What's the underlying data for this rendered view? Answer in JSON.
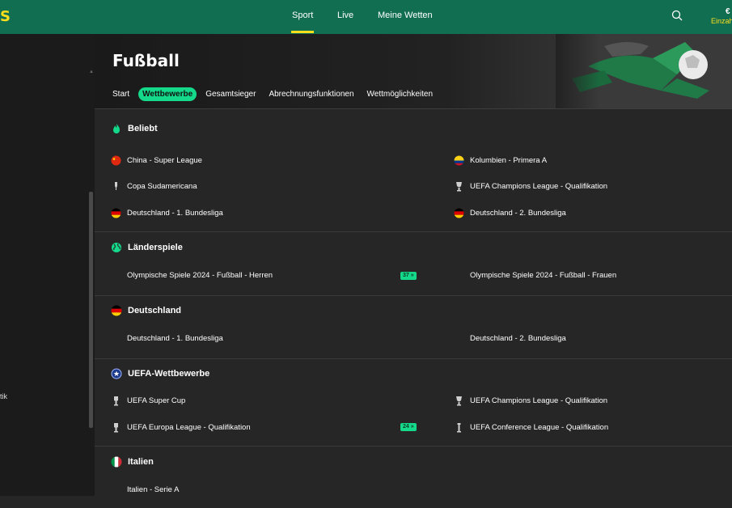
{
  "header": {
    "logo_text": "S",
    "nav": [
      {
        "label": "Sport",
        "active": true
      },
      {
        "label": "Live",
        "active": false
      },
      {
        "label": "Meine Wetten",
        "active": false
      }
    ],
    "balance": "€",
    "single_bet_label": "Einzah"
  },
  "sidebar": {
    "partial_text": "tik"
  },
  "hero": {
    "title": "Fußball",
    "tabs": [
      {
        "label": "Start",
        "active": false
      },
      {
        "label": "Wettbewerbe",
        "active": true
      },
      {
        "label": "Gesamtsieger",
        "active": false
      },
      {
        "label": "Abrechnungsfunktionen",
        "active": false
      },
      {
        "label": "Wettmöglichkeiten",
        "active": false
      }
    ]
  },
  "sections": [
    {
      "title": "Beliebt",
      "icon": "flame-icon",
      "items": [
        {
          "label": "China - Super League",
          "icon": "flag-china-icon"
        },
        {
          "label": "Kolumbien - Primera A",
          "icon": "flag-colombia-icon"
        },
        {
          "label": "Copa Sudamericana",
          "icon": "trophy-icon"
        },
        {
          "label": "UEFA Champions League - Qualifikation",
          "icon": "trophy-cup-icon"
        },
        {
          "label": "Deutschland - 1. Bundesliga",
          "icon": "flag-germany-icon"
        },
        {
          "label": "Deutschland - 2. Bundesliga",
          "icon": "flag-germany-icon"
        }
      ]
    },
    {
      "title": "Länderspiele",
      "icon": "globe-icon",
      "items": [
        {
          "label": "Olympische Spiele 2024 - Fußball - Herren",
          "badge": "37 »"
        },
        {
          "label": "Olympische Spiele 2024 - Fußball - Frauen"
        }
      ]
    },
    {
      "title": "Deutschland",
      "icon": "flag-germany-icon",
      "items": [
        {
          "label": "Deutschland - 1. Bundesliga"
        },
        {
          "label": "Deutschland - 2. Bundesliga"
        }
      ]
    },
    {
      "title": "UEFA-Wettbewerbe",
      "icon": "uefa-star-icon",
      "items": [
        {
          "label": "UEFA Super Cup",
          "icon": "trophy-icon"
        },
        {
          "label": "UEFA Champions League - Qualifikation",
          "icon": "trophy-cup-icon"
        },
        {
          "label": "UEFA Europa League - Qualifikation",
          "icon": "trophy-icon",
          "badge": "24 »"
        },
        {
          "label": "UEFA Conference League - Qualifikation",
          "icon": "trophy-slim-icon"
        }
      ]
    },
    {
      "title": "Italien",
      "icon": "flag-italy-icon",
      "items": [
        {
          "label": "Italien - Serie A"
        }
      ]
    }
  ],
  "colors": {
    "brand_green": "#126e51",
    "accent_yellow": "#ffdf1b",
    "highlight_green": "#14d98a",
    "background": "#262626"
  }
}
